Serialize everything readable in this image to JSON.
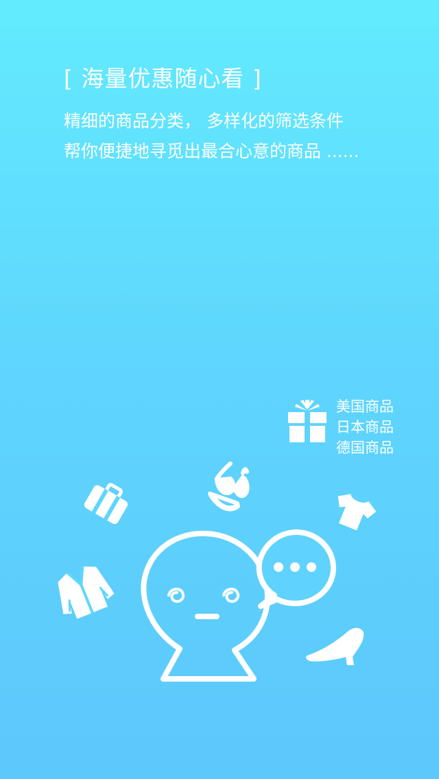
{
  "headline": "[ 海量优惠随心看 ]",
  "description": {
    "line1": "精细的商品分类， 多样化的筛选条件",
    "line2": "帮你便捷地寻觅出最合心意的商品 ......"
  },
  "origins": [
    {
      "label": "美国商品"
    },
    {
      "label": "日本商品"
    },
    {
      "label": "德国商品"
    }
  ],
  "icons": {
    "gift": "gift-icon",
    "bra": "bra-icon",
    "suitcase": "suitcase-icon",
    "tshirt": "tshirt-icon",
    "jacket": "jacket-icon",
    "mascot": "mascot-icon",
    "speech": "speech-bubble-icon",
    "heel": "high-heel-icon"
  },
  "colors": {
    "background_top": "#62EBFE",
    "background_bottom": "#5CC8FC",
    "foreground": "#FFFFFF"
  }
}
